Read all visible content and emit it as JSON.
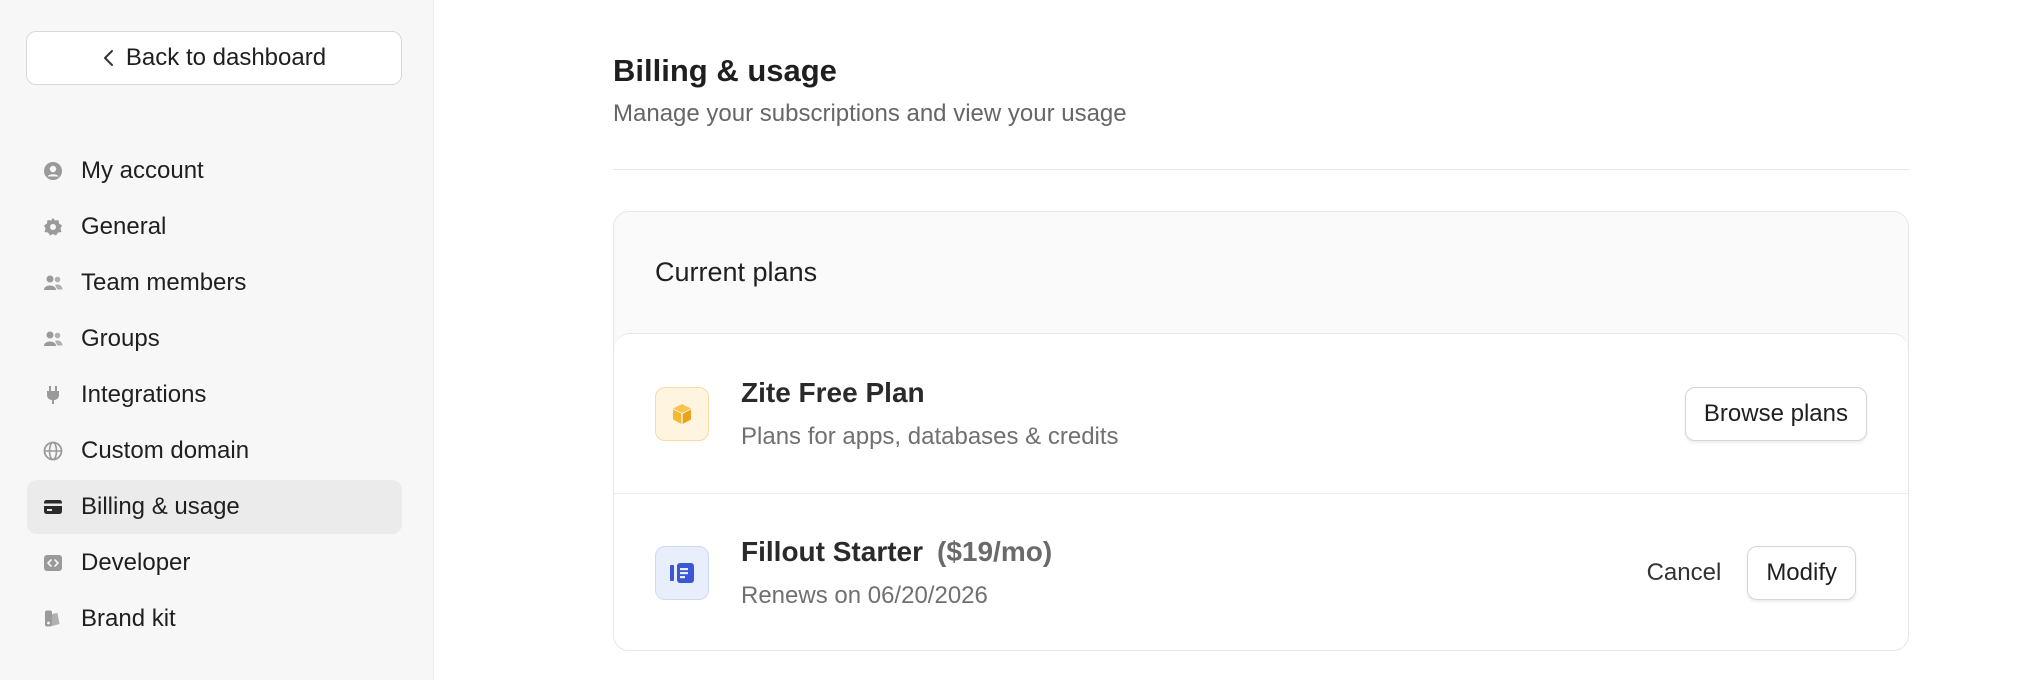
{
  "sidebar": {
    "back_label": "Back to dashboard",
    "items": [
      {
        "label": "My account",
        "icon": "user-circle-icon"
      },
      {
        "label": "General",
        "icon": "gear-icon"
      },
      {
        "label": "Team members",
        "icon": "users-icon"
      },
      {
        "label": "Groups",
        "icon": "users-icon"
      },
      {
        "label": "Integrations",
        "icon": "plug-icon"
      },
      {
        "label": "Custom domain",
        "icon": "globe-icon"
      },
      {
        "label": "Billing & usage",
        "icon": "credit-card-icon",
        "active": true
      },
      {
        "label": "Developer",
        "icon": "code-icon"
      },
      {
        "label": "Brand kit",
        "icon": "palette-icon"
      }
    ]
  },
  "main": {
    "title": "Billing & usage",
    "subtitle": "Manage your subscriptions and view your usage",
    "current_plans": {
      "heading": "Current plans",
      "plans": [
        {
          "name": "Zite Free Plan",
          "description": "Plans for apps, databases & credits",
          "icon": "cube-icon",
          "action_label": "Browse plans"
        },
        {
          "name": "Fillout Starter",
          "price": "($19/mo)",
          "description": "Renews on 06/20/2026",
          "icon": "fillout-logo-icon",
          "cancel_label": "Cancel",
          "modify_label": "Modify"
        }
      ]
    }
  },
  "colors": {
    "accent_orange": "#f5b830",
    "accent_blue": "#3b57d6",
    "active_nav_bg": "#ebebeb"
  }
}
